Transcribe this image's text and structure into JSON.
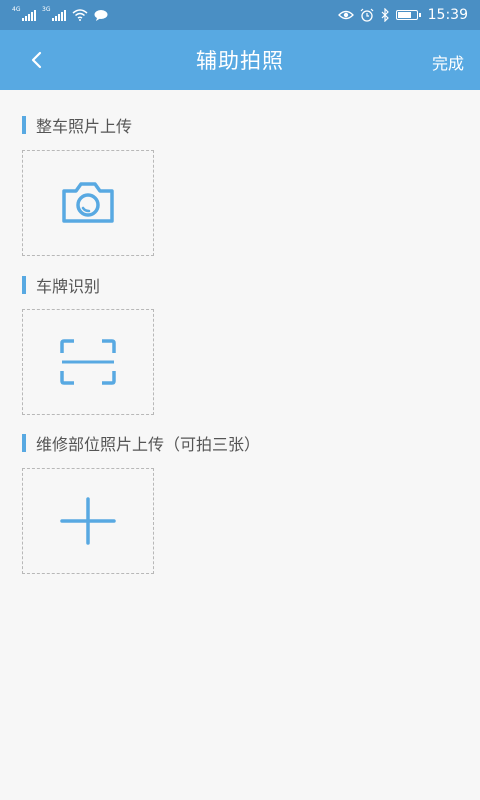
{
  "status_bar": {
    "network_1": "4G",
    "network_2": "3G",
    "time": "15:39",
    "battery_level": 0.7,
    "icons": [
      "signal-icon",
      "signal-icon",
      "wifi-icon",
      "message-icon",
      "eye-icon",
      "alarm-icon",
      "bluetooth-icon",
      "battery-icon"
    ]
  },
  "header": {
    "title": "辅助拍照",
    "done_label": "完成",
    "back_icon": "chevron-left-icon"
  },
  "sections": [
    {
      "label": "整车照片上传",
      "icon": "camera-icon"
    },
    {
      "label": "车牌识别",
      "icon": "scan-icon"
    },
    {
      "label": "维修部位照片上传（可拍三张）",
      "icon": "plus-icon"
    }
  ],
  "colors": {
    "status_bar": "#4a8fc4",
    "app_bar": "#58a9e2",
    "accent": "#58a9e2",
    "background": "#f7f7f7",
    "dashed_border": "#b8b8b8"
  }
}
